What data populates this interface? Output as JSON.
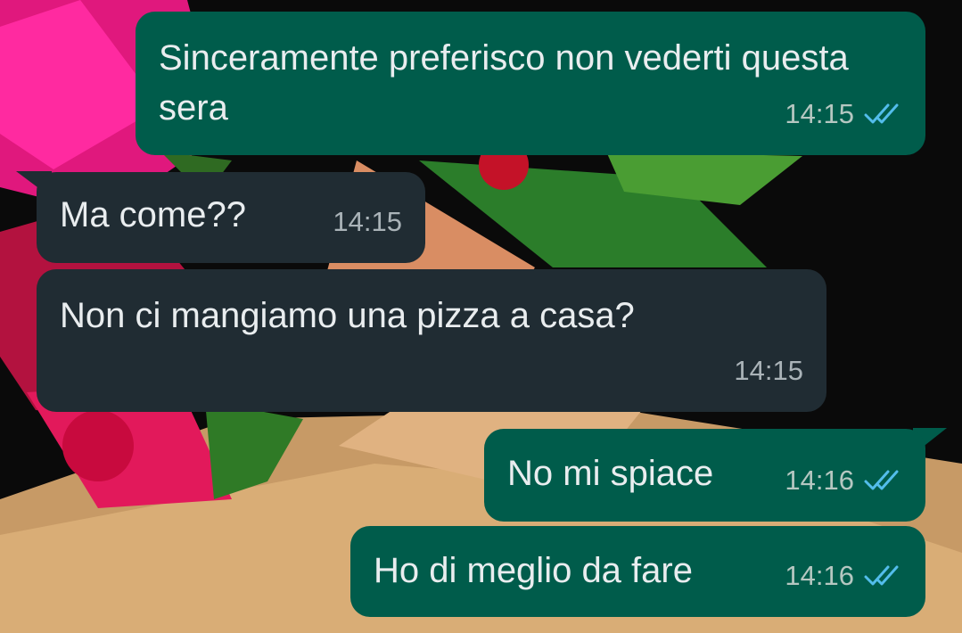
{
  "colors": {
    "incoming_bubble": "#202c33",
    "outgoing_bubble": "#005c4b",
    "text": "#e9edef",
    "read_ticks": "#53bdeb"
  },
  "chat": {
    "messages": [
      {
        "direction": "outgoing",
        "text": "Sinceramente preferisco non vederti questa sera",
        "time": "14:15",
        "status": "read",
        "status_icon": "double-check-icon"
      },
      {
        "direction": "incoming",
        "text": "Ma come??",
        "time": "14:15"
      },
      {
        "direction": "incoming",
        "text": "Non ci mangiamo una pizza a casa?",
        "time": "14:15"
      },
      {
        "direction": "outgoing",
        "text": "No mi spiace",
        "time": "14:16",
        "status": "read",
        "status_icon": "double-check-icon"
      },
      {
        "direction": "outgoing",
        "text": "Ho di meglio da fare",
        "time": "14:16",
        "status": "read",
        "status_icon": "double-check-icon"
      }
    ]
  }
}
